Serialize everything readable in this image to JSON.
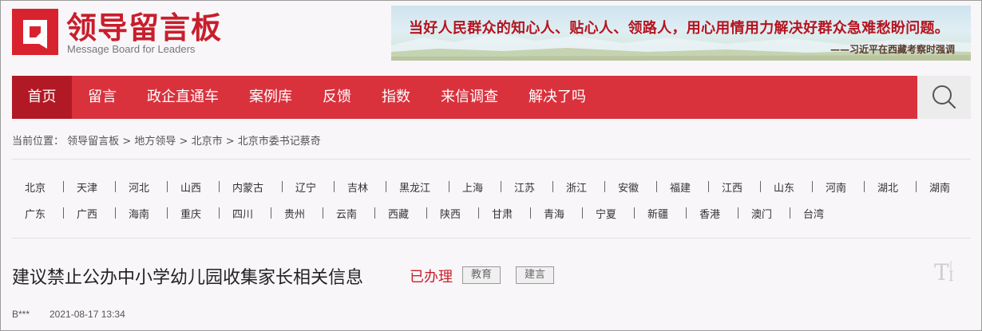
{
  "header": {
    "logo_icon": "message-board-logo-icon",
    "logo_cn": "领导留言板",
    "logo_en": "Message Board for Leaders",
    "banner_quote": "当好人民群众的知心人、贴心人、领路人，用心用情用力解决好群众急难愁盼问题。",
    "banner_source": "——习近平在西藏考察时强调"
  },
  "nav": {
    "items": [
      {
        "label": "首页",
        "active": true
      },
      {
        "label": "留言"
      },
      {
        "label": "政企直通车"
      },
      {
        "label": "案例库"
      },
      {
        "label": "反馈"
      },
      {
        "label": "指数"
      },
      {
        "label": "来信调查"
      },
      {
        "label": "解决了吗"
      }
    ],
    "search_icon": "search-icon"
  },
  "breadcrumb": {
    "prefix": "当前位置：",
    "items": [
      "领导留言板",
      "地方领导",
      "北京市",
      "北京市委书记蔡奇"
    ],
    "separator": ">"
  },
  "regions": {
    "row1": [
      "北京",
      "天津",
      "河北",
      "山西",
      "内蒙古",
      "辽宁",
      "吉林",
      "黑龙江",
      "上海",
      "江苏",
      "浙江",
      "安徽",
      "福建",
      "江西",
      "山东",
      "河南",
      "湖北",
      "湖南"
    ],
    "row2": [
      "广东",
      "广西",
      "海南",
      "重庆",
      "四川",
      "贵州",
      "云南",
      "西藏",
      "陕西",
      "甘肃",
      "青海",
      "宁夏",
      "新疆",
      "香港",
      "澳门",
      "台湾"
    ]
  },
  "message": {
    "title": "建议禁止公办中小学幼儿园收集家长相关信息",
    "status": "已办理",
    "tags": [
      "教育",
      "建言"
    ],
    "font_toggle_icon": "font-size-icon",
    "author": "B***",
    "date": "2021-08-17 13:34"
  },
  "colors": {
    "brand_red": "#d9323d",
    "nav_active": "#b11a25",
    "status_red": "#c8202d"
  }
}
